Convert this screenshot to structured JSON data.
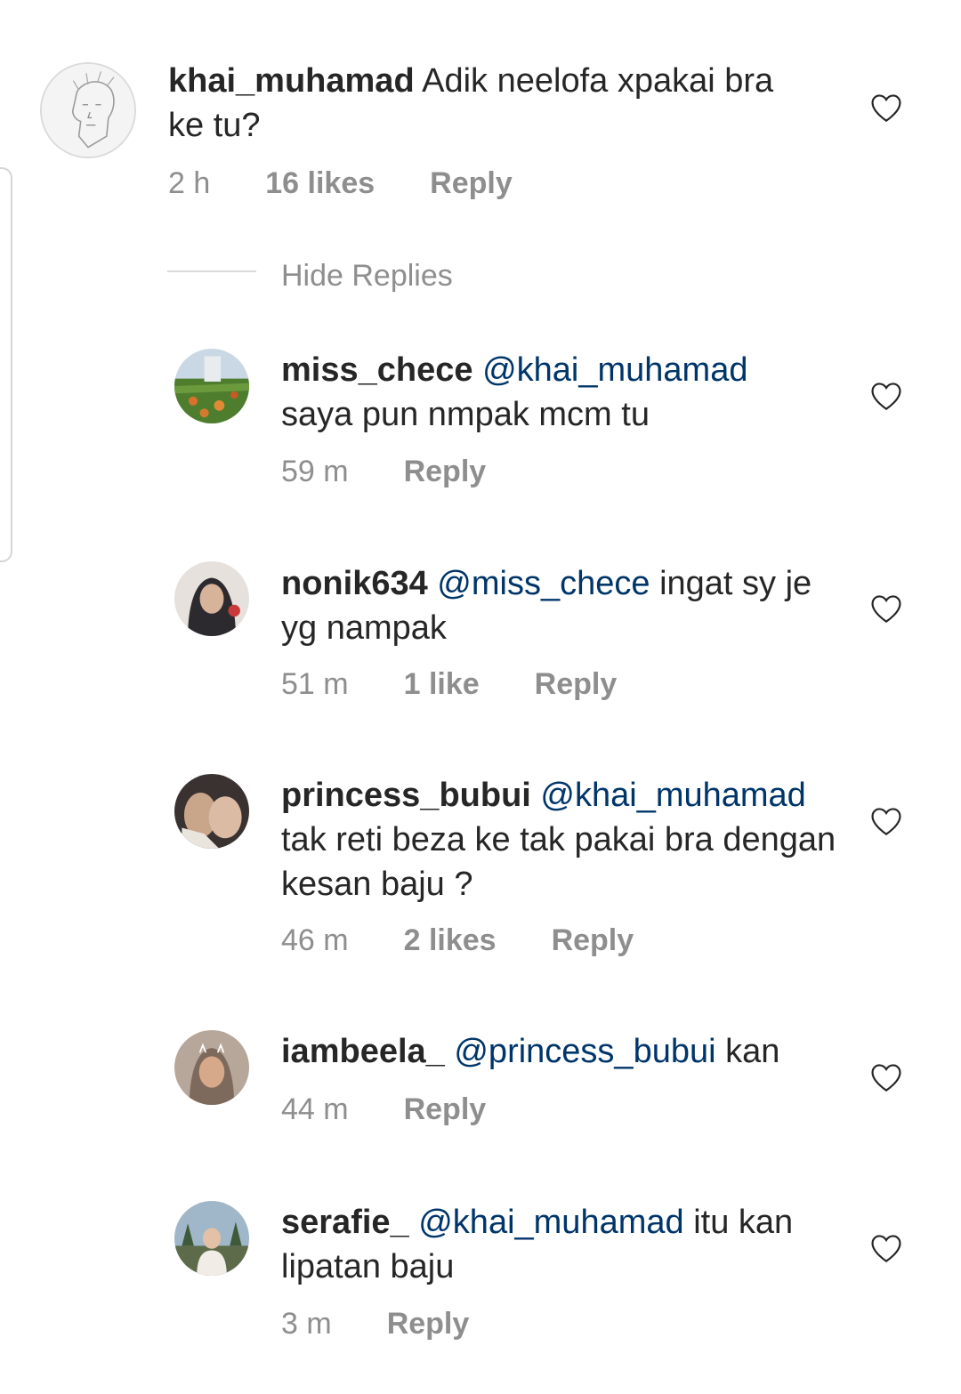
{
  "parent_comment": {
    "username": "khai_muhamad",
    "text": " Adik neelofa xpakai bra ke tu?",
    "time": "2 h",
    "likes": "16 likes",
    "reply": "Reply"
  },
  "hide_replies_label": "Hide Replies",
  "replies": [
    {
      "username": "miss_chece",
      "mention": "@khai_muhamad",
      "text": "saya pun nmpak mcm tu",
      "time": "59 m",
      "likes": "",
      "reply": "Reply"
    },
    {
      "username": "nonik634",
      "mention": "@miss_chece",
      "text": " ingat sy je yg nampak",
      "time": "51 m",
      "likes": "1 like",
      "reply": "Reply"
    },
    {
      "username": "princess_bubui",
      "mention": "@khai_muhamad",
      "text": "tak reti beza ke tak pakai bra dengan kesan baju ?",
      "time": "46 m",
      "likes": "2 likes",
      "reply": "Reply"
    },
    {
      "username": "iambeela_",
      "mention": "@princess_bubui",
      "text": " kan",
      "time": "44 m",
      "likes": "",
      "reply": "Reply"
    },
    {
      "username": "serafie_",
      "mention": "@khai_muhamad",
      "text": " itu kan lipatan baju",
      "time": "3 m",
      "likes": "",
      "reply": "Reply"
    }
  ],
  "colors": {
    "text": "#262626",
    "meta": "#8e8e8e",
    "mention": "#003569"
  }
}
